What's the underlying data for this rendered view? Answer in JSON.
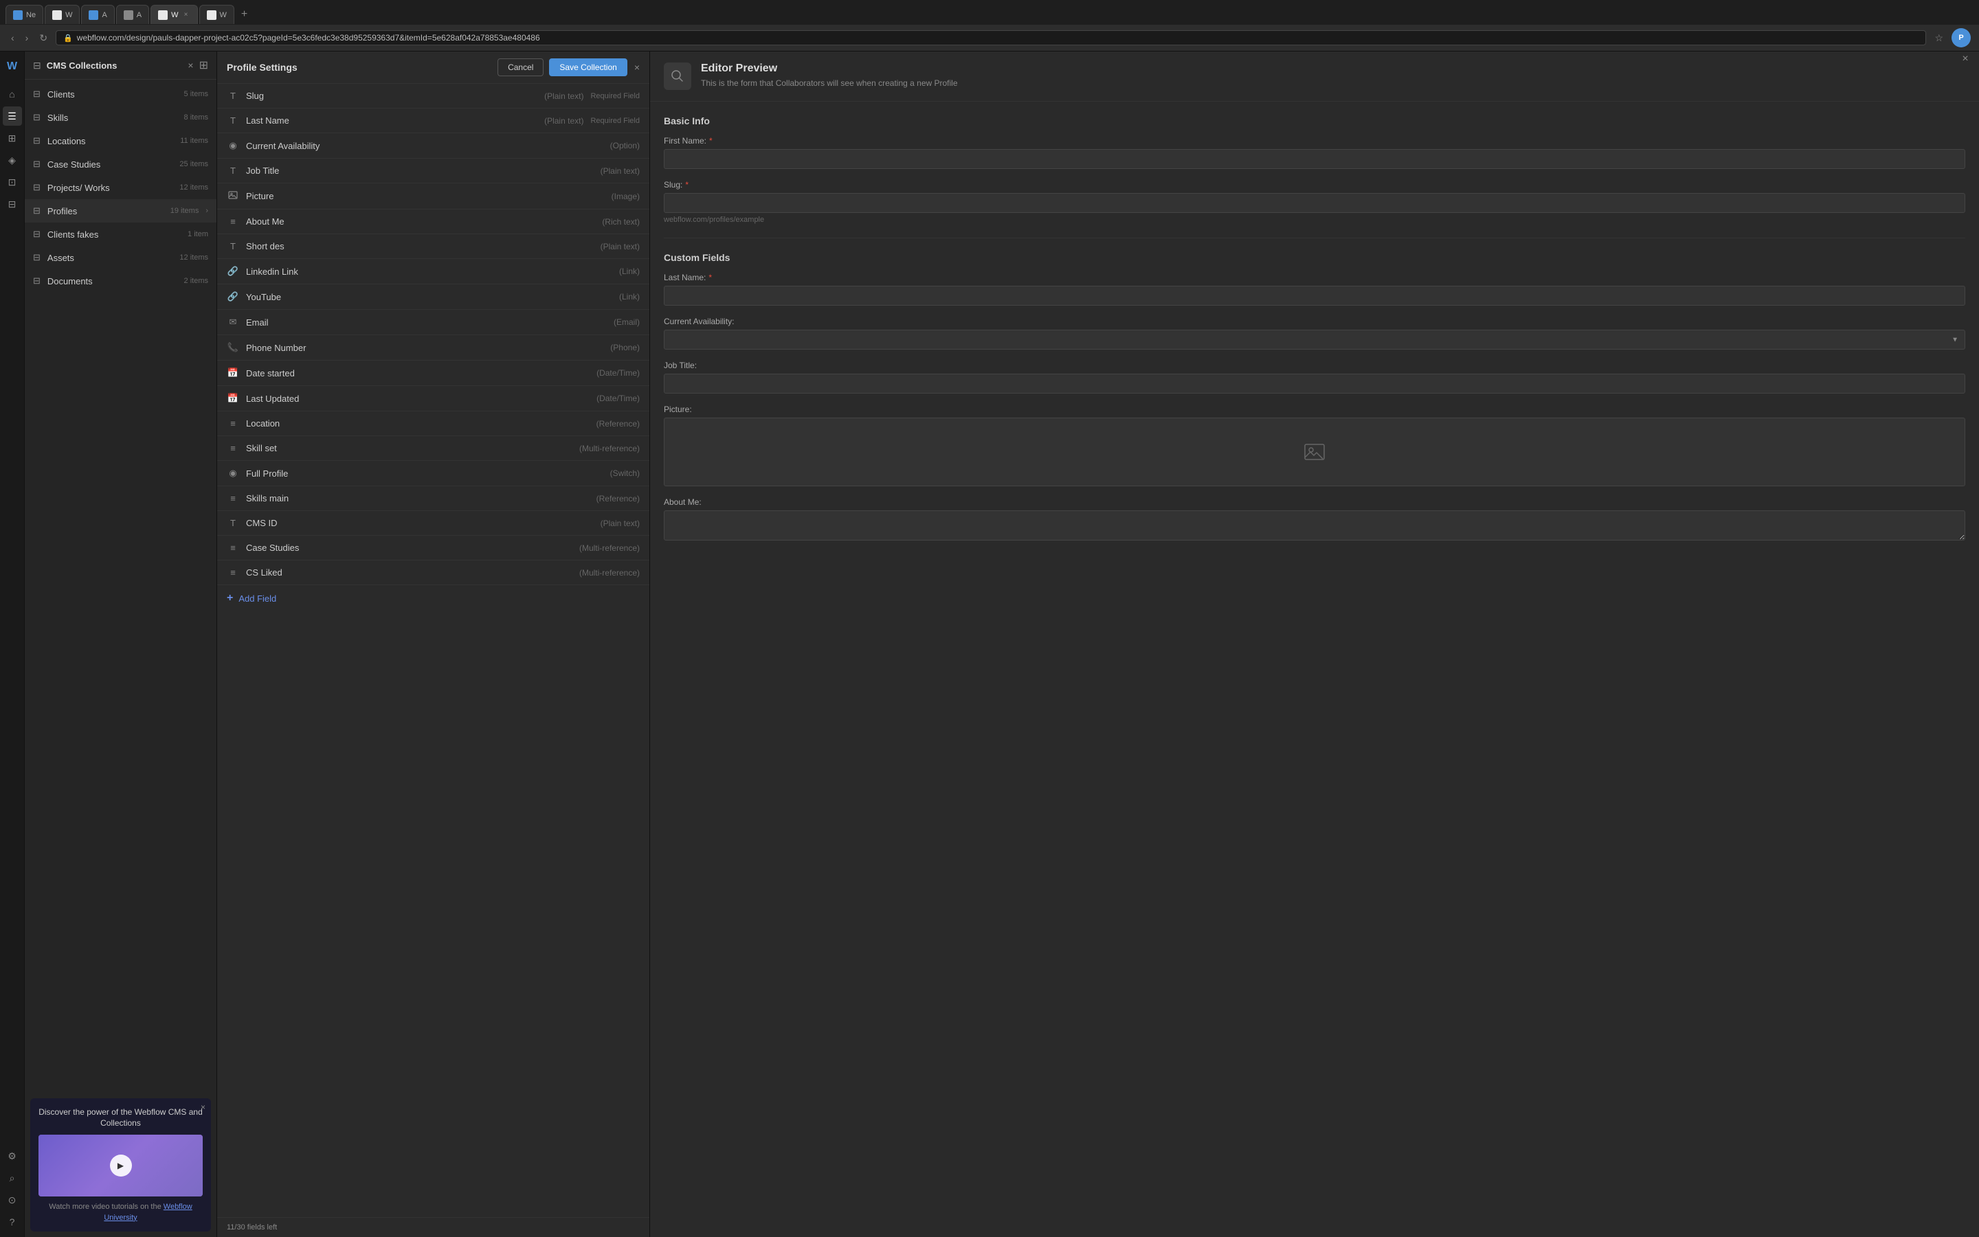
{
  "browser": {
    "url": "webflow.com/design/pauls-dapper-project-ac02c5?pageId=5e3c6fedc3e38d95259363d7&itemId=5e628af042a78853ae480486",
    "tabs": [
      {
        "label": "Ne",
        "active": false
      },
      {
        "label": "W",
        "active": false
      },
      {
        "label": "A",
        "active": false
      },
      {
        "label": "A",
        "active": false
      },
      {
        "label": "W",
        "active": true
      },
      {
        "label": "W",
        "active": false
      }
    ]
  },
  "cms": {
    "title": "CMS Collections",
    "collections": [
      {
        "name": "Clients",
        "count": "5 items"
      },
      {
        "name": "Skills",
        "count": "8 items"
      },
      {
        "name": "Locations",
        "count": "11 items"
      },
      {
        "name": "Case Studies",
        "count": "25 items"
      },
      {
        "name": "Projects/ Works",
        "count": "12 items"
      },
      {
        "name": "Profiles",
        "count": "19 items",
        "active": true,
        "hasChevron": true
      },
      {
        "name": "Clients fakes",
        "count": "1 item"
      },
      {
        "name": "Assets",
        "count": "12 items"
      },
      {
        "name": "Documents",
        "count": "2 items"
      }
    ],
    "promo": {
      "title": "Discover the power of the Webflow CMS and Collections",
      "footer_text": "Watch more video tutorials on the",
      "footer_link": "Webflow University"
    }
  },
  "settings": {
    "title": "Profile Settings",
    "cancel_label": "Cancel",
    "save_label": "Save Collection",
    "fields": [
      {
        "icon": "T",
        "name": "Slug",
        "type": "(Plain text)",
        "required": "Required Field"
      },
      {
        "icon": "T",
        "name": "Last Name",
        "type": "(Plain text)",
        "required": "Required Field"
      },
      {
        "icon": "◉",
        "name": "Current Availability",
        "type": "(Option)",
        "required": ""
      },
      {
        "icon": "T",
        "name": "Job Title",
        "type": "(Plain text)",
        "required": ""
      },
      {
        "icon": "🖼",
        "name": "Picture",
        "type": "(Image)",
        "required": ""
      },
      {
        "icon": "≡",
        "name": "About Me",
        "type": "(Rich text)",
        "required": ""
      },
      {
        "icon": "T",
        "name": "Short des",
        "type": "(Plain text)",
        "required": ""
      },
      {
        "icon": "🔗",
        "name": "Linkedin Link",
        "type": "(Link)",
        "required": ""
      },
      {
        "icon": "🔗",
        "name": "YouTube",
        "type": "(Link)",
        "required": ""
      },
      {
        "icon": "✉",
        "name": "Email",
        "type": "(Email)",
        "required": ""
      },
      {
        "icon": "📞",
        "name": "Phone Number",
        "type": "(Phone)",
        "required": ""
      },
      {
        "icon": "📅",
        "name": "Date started",
        "type": "(Date/Time)",
        "required": ""
      },
      {
        "icon": "📅",
        "name": "Last Updated",
        "type": "(Date/Time)",
        "required": ""
      },
      {
        "icon": "≡",
        "name": "Location",
        "type": "(Reference)",
        "required": ""
      },
      {
        "icon": "≡",
        "name": "Skill set",
        "type": "(Multi-reference)",
        "required": ""
      },
      {
        "icon": "◉",
        "name": "Full Profile",
        "type": "(Switch)",
        "required": ""
      },
      {
        "icon": "≡",
        "name": "Skills main",
        "type": "(Reference)",
        "required": ""
      },
      {
        "icon": "T",
        "name": "CMS ID",
        "type": "(Plain text)",
        "required": ""
      },
      {
        "icon": "≡",
        "name": "Case Studies",
        "type": "(Multi-reference)",
        "required": ""
      },
      {
        "icon": "≡",
        "name": "CS Liked",
        "type": "(Multi-reference)",
        "required": ""
      }
    ],
    "add_field_label": "Add Field",
    "fields_left": "11/30 fields left"
  },
  "preview": {
    "title": "Editor Preview",
    "subtitle": "This is the form that Collaborators will see when creating a new Profile",
    "sections": {
      "basic_info": {
        "title": "Basic Info",
        "fields": [
          {
            "label": "First Name:",
            "required": true,
            "type": "input",
            "hint": ""
          },
          {
            "label": "Slug:",
            "required": true,
            "type": "input",
            "hint": "webflow.com/profiles/example"
          }
        ]
      },
      "custom_fields": {
        "title": "Custom Fields",
        "fields": [
          {
            "label": "Last Name:",
            "required": true,
            "type": "input",
            "hint": ""
          },
          {
            "label": "Current Availability:",
            "required": false,
            "type": "select",
            "hint": ""
          },
          {
            "label": "Job Title:",
            "required": false,
            "type": "input",
            "hint": ""
          },
          {
            "label": "Picture:",
            "required": false,
            "type": "picture",
            "hint": ""
          },
          {
            "label": "About Me:",
            "required": false,
            "type": "textarea",
            "hint": ""
          }
        ]
      }
    }
  },
  "icons": {
    "cms_collection": "⊟",
    "toolbar_home": "⌂",
    "toolbar_layers": "☰",
    "toolbar_pages": "⊞",
    "toolbar_symbols": "◈",
    "toolbar_store": "⊡",
    "toolbar_cms": "⊟",
    "toolbar_settings": "⚙",
    "toolbar_search": "⌕",
    "toolbar_users": "⊙",
    "toolbar_help": "?",
    "close": "×",
    "chevron_right": "›",
    "play": "▶",
    "add": "+"
  }
}
